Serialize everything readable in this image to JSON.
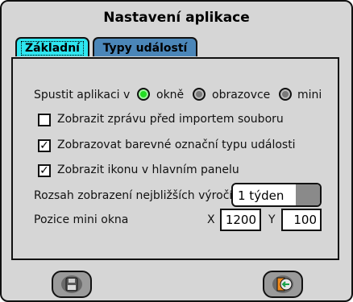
{
  "window": {
    "title": "Nastavení aplikace"
  },
  "tabs": [
    {
      "label": "Základní"
    },
    {
      "label": "Typy událostí"
    }
  ],
  "basic": {
    "launch": {
      "label": "Spustit aplikaci v",
      "options": [
        "okně",
        "obrazovce",
        "mini"
      ],
      "selected": "okně"
    },
    "checkboxes": [
      {
        "label": "Zobrazit zprávu před importem souboru",
        "checked": false
      },
      {
        "label": "Zobrazovat barevné označní typu události",
        "checked": true
      },
      {
        "label": "Zobrazit ikonu v hlavním panelu",
        "checked": true
      }
    ],
    "range": {
      "label": "Rozsah zobrazení nejbližších výročí",
      "value": "1 týden"
    },
    "mini_position": {
      "label": "Pozice mini okna",
      "x_label": "X",
      "x_value": "1200",
      "y_label": "Y",
      "y_value": "100"
    }
  },
  "buttons": {
    "save_icon": "floppy-disk-icon",
    "exit_icon": "door-exit-icon"
  },
  "colors": {
    "active_tab": "#2ee6f0",
    "inactive_tab": "#4b86b8",
    "radio_on": "#22dd22"
  }
}
